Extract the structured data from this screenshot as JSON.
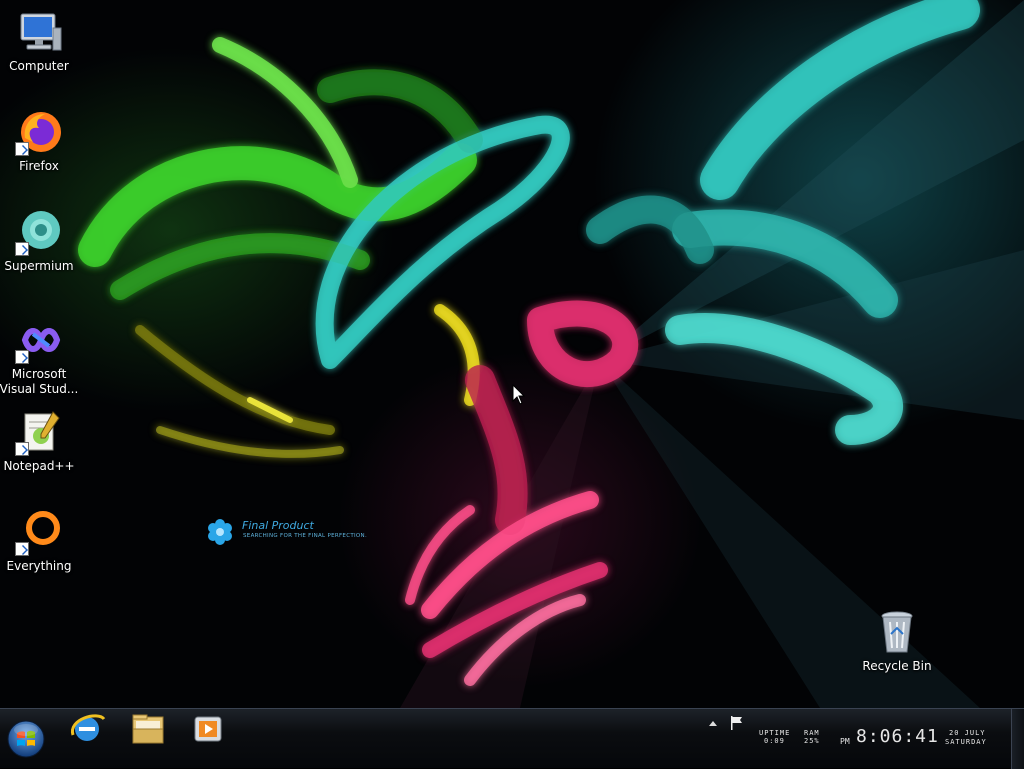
{
  "desktop": {
    "icons": [
      {
        "label": "Computer",
        "icon": "computer-icon"
      },
      {
        "label": "Firefox",
        "icon": "firefox-icon"
      },
      {
        "label": "Supermium",
        "icon": "supermium-icon"
      },
      {
        "label": "Microsoft Visual Stud...",
        "icon": "visual-studio-icon"
      },
      {
        "label": "Notepad++",
        "icon": "notepadpp-icon"
      },
      {
        "label": "Everything",
        "icon": "everything-icon"
      }
    ],
    "recycle_bin": {
      "label": "Recycle Bin",
      "icon": "recycle-bin-icon"
    },
    "gadget": {
      "title": "Final Product",
      "subtitle": "SEARCHING FOR THE FINAL PERFECTION."
    }
  },
  "taskbar": {
    "start": {
      "icon": "windows-start-orb-icon"
    },
    "pinned": [
      {
        "name": "Internet Explorer",
        "icon": "internet-explorer-icon"
      },
      {
        "name": "Windows Explorer",
        "icon": "folder-icon"
      },
      {
        "name": "Media Player",
        "icon": "media-player-icon"
      }
    ],
    "tray": {
      "uptime_label": "UPTIME",
      "uptime_value": "0:09",
      "ram_label": "RAM",
      "ram_value": "25%",
      "ampm": "PM",
      "time": "8:06:41",
      "date": "20 JULY",
      "day": "SATURDAY"
    }
  },
  "colors": {
    "taskbar_bg": "#0b0d10",
    "gadget_blue": "#3fa9e0",
    "wall_green": "#3ccf2a",
    "wall_teal": "#33c9c0",
    "wall_pink": "#e0306e",
    "wall_yellow": "#f0e020"
  }
}
